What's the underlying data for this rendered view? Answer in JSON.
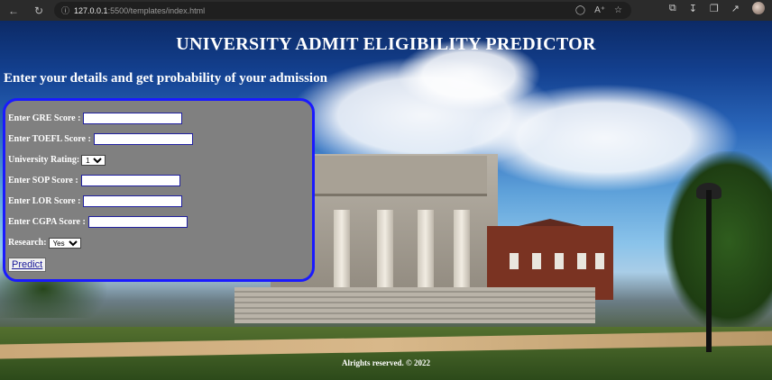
{
  "browser": {
    "url_host": "127.0.0.1",
    "url_rest": ":5500/templates/index.html"
  },
  "page": {
    "title": "UNIVERSITY ADMIT ELIGIBILITY PREDICTOR",
    "subtitle": "Enter your details and get probability of your admission",
    "form": {
      "gre_label": "Enter GRE Score :",
      "toefl_label": "Enter TOEFL Score :",
      "rating_label": "University Rating:",
      "rating_value": "1",
      "sop_label": "Enter SOP Score :",
      "lor_label": "Enter LOR Score :",
      "cgpa_label": "Enter CGPA Score :",
      "research_label": "Research:",
      "research_value": "Yes",
      "predict_label": "Predict"
    },
    "footer": "Alrights reserved. © 2022"
  }
}
